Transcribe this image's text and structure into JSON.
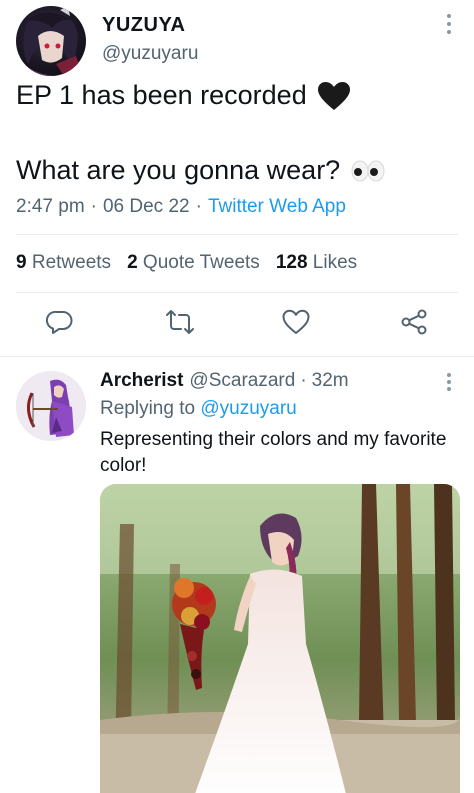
{
  "main_tweet": {
    "author_name": "YUZUYA",
    "author_handle": "@yuzuyaru",
    "line1": "EP 1 has been recorded",
    "line2": "What are you gonna wear?",
    "time": "2:47 pm",
    "date": "06 Dec 22",
    "separator": "·",
    "app": "Twitter Web App",
    "stats": {
      "retweets_count": "9",
      "retweets_label": "Retweets",
      "quotes_count": "2",
      "quotes_label": "Quote Tweets",
      "likes_count": "128",
      "likes_label": "Likes"
    },
    "icons": [
      "black-heart-icon",
      "eyes-icon",
      "more-icon",
      "reply-icon",
      "retweet-icon",
      "like-icon",
      "share-icon"
    ]
  },
  "reply": {
    "author_name": "Archerist",
    "author_handle": "@Scarazard",
    "separator": "·",
    "time": "32m",
    "replying_prefix": "Replying to",
    "replying_to": "@yuzuyaru",
    "text": "Representing their colors and my favorite color!"
  },
  "colors": {
    "accent": "#1d9bf0",
    "secondary_text": "#536471",
    "primary_text": "#0f1419",
    "divider": "#e6ecf0"
  }
}
